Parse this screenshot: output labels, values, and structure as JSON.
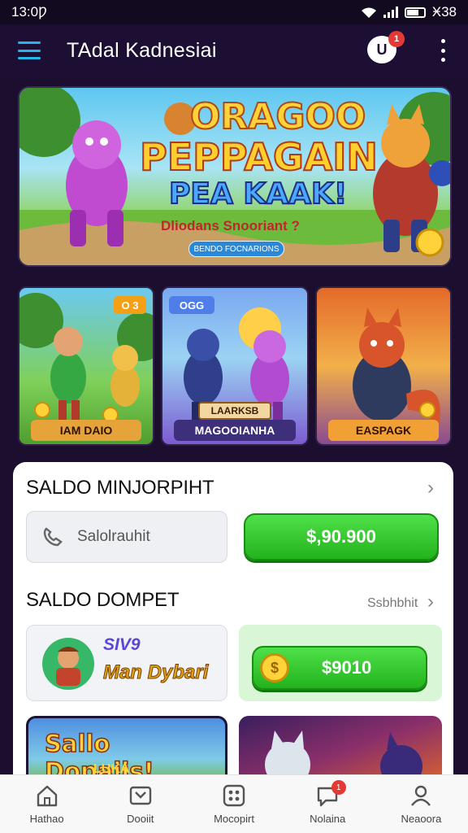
{
  "status_bar": {
    "time": "13:0Ƿ",
    "battery_text": "Ӿ38"
  },
  "header": {
    "title": "TAdal Kadnesiai",
    "chat_badge": "1",
    "chat_glyph": "U"
  },
  "hero": {
    "line1": "ORAGOO",
    "line2": "PEPPAGAIN",
    "line3": "PEA KAAK!",
    "subtitle": "Dliodans Snooriant ?",
    "pill": "BENDO FOCNARIONS"
  },
  "cards": [
    {
      "label": "IAM DAIO",
      "badge": "O 3"
    },
    {
      "label": "MAGOOIANHA",
      "badge": "OGG",
      "banner": "LAARKSB"
    },
    {
      "label": "EASPAGK"
    }
  ],
  "wallet": {
    "section1_title": "SALDO MINJORPIHT",
    "input_placeholder": "Salolrauhit",
    "balance_button": "$,90.900",
    "section2_title": "SALDO DOMPET",
    "see_more": "Ssbhbhit",
    "promo_line1": "SIV9",
    "promo_line2": "Man Dybari",
    "coin_button": "$9010",
    "bottom_card_title": "Sallo Dopaiis!",
    "bottom_card_sub": "LUKA"
  },
  "nav": [
    {
      "label": "Hathao",
      "icon": "home-icon"
    },
    {
      "label": "Dooiit",
      "icon": "wallet-icon"
    },
    {
      "label": "Mocopirt",
      "icon": "games-icon"
    },
    {
      "label": "Nolaina",
      "icon": "chat-icon",
      "badge": "1"
    },
    {
      "label": "Neaoora",
      "icon": "profile-icon"
    }
  ],
  "colors": {
    "accent": "#27b5e8",
    "green": "#23b31c",
    "panel": "#ffffff",
    "background": "#1b0e2e"
  }
}
